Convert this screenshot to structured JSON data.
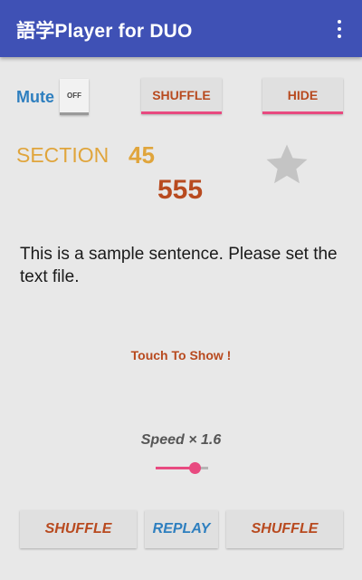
{
  "appbar": {
    "title": "語学Player for DUO",
    "menu_icon": "more-vert-icon"
  },
  "controls": {
    "mute_label": "Mute",
    "toggle_label": "OFF",
    "shuffle_label": "SHUFFLE",
    "hide_label": "HIDE"
  },
  "section": {
    "label": "SECTION",
    "number": "45",
    "sub_number": "555",
    "star_icon": "star-icon"
  },
  "content": {
    "sentence": "This is a sample sentence. Please set the text file.",
    "touch_prompt": "Touch To Show !"
  },
  "speed": {
    "label": "Speed × 1.6",
    "slider_fraction": 0.75
  },
  "bottom_bar": {
    "shuffle_left_label": "SHUFFLE",
    "replay_label": "REPLAY",
    "shuffle_right_label": "SHUFFLE"
  },
  "colors": {
    "appbar": "#3f51b5",
    "accent": "#e84a80",
    "orange_text": "#b84a1f",
    "gold_text": "#e0a53c",
    "blue_text": "#2e7fbf",
    "star": "#c4c4c4"
  }
}
